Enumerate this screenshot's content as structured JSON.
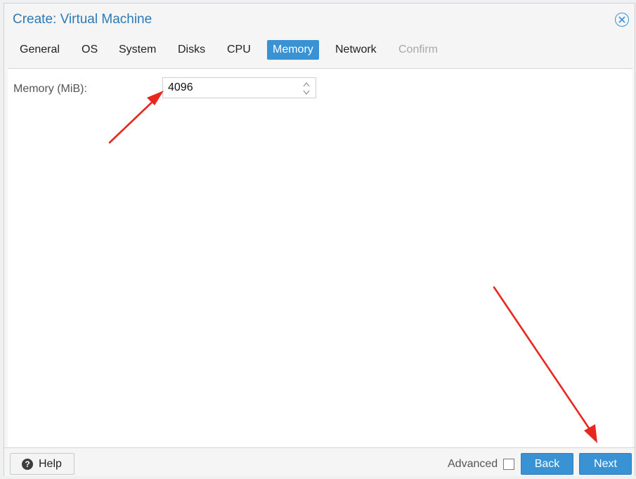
{
  "dialog": {
    "title": "Create: Virtual Machine",
    "close_icon": "close-circle-icon"
  },
  "tabs": [
    {
      "label": "General",
      "state": "normal"
    },
    {
      "label": "OS",
      "state": "normal"
    },
    {
      "label": "System",
      "state": "normal"
    },
    {
      "label": "Disks",
      "state": "normal"
    },
    {
      "label": "CPU",
      "state": "normal"
    },
    {
      "label": "Memory",
      "state": "active"
    },
    {
      "label": "Network",
      "state": "normal"
    },
    {
      "label": "Confirm",
      "state": "disabled"
    }
  ],
  "memory": {
    "label": "Memory (MiB):",
    "value": "4096"
  },
  "footer": {
    "help_label": "Help",
    "help_icon": "question-circle-icon",
    "advanced_label": "Advanced",
    "advanced_checked": false,
    "back_label": "Back",
    "next_label": "Next"
  },
  "colors": {
    "accent": "#3892d4",
    "title": "#2a7ab8",
    "annotation_arrow": "#e8281e"
  }
}
